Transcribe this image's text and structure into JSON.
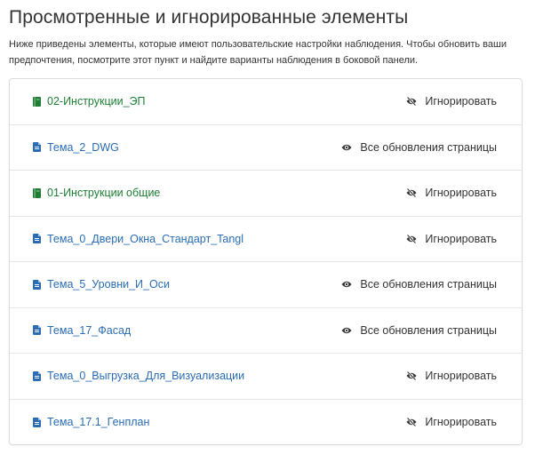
{
  "page": {
    "title": "Просмотренные и игнорированные элементы",
    "description": "Ниже приведены элементы, которые имеют пользовательские настройки наблюдения. Чтобы обновить ваши предпочтения, посмотрите этот пункт и найдите варианты наблюдения в боковой панели."
  },
  "colors": {
    "book_green": "#1e7e34",
    "page_blue": "#2a6db5",
    "text": "#333333"
  },
  "items": [
    {
      "name": "02-Инструкции_ЭП",
      "type": "book",
      "icon": "book-icon",
      "status": "Игнорировать",
      "status_icon": "eye-slash-icon"
    },
    {
      "name": "Тема_2_DWG",
      "type": "page",
      "icon": "page-icon",
      "status": "Все обновления страницы",
      "status_icon": "eye-icon"
    },
    {
      "name": "01-Инструкции общие",
      "type": "book",
      "icon": "book-icon",
      "status": "Игнорировать",
      "status_icon": "eye-slash-icon"
    },
    {
      "name": "Тема_0_Двери_Окна_Стандарт_Tangl",
      "type": "page",
      "icon": "page-icon",
      "status": "Игнорировать",
      "status_icon": "eye-slash-icon"
    },
    {
      "name": "Тема_5_Уровни_И_Оси",
      "type": "page",
      "icon": "page-icon",
      "status": "Все обновления страницы",
      "status_icon": "eye-icon"
    },
    {
      "name": "Тема_17_Фасад",
      "type": "page",
      "icon": "page-icon",
      "status": "Все обновления страницы",
      "status_icon": "eye-icon"
    },
    {
      "name": "Тема_0_Выгрузка_Для_Визуализации",
      "type": "page",
      "icon": "page-icon",
      "status": "Игнорировать",
      "status_icon": "eye-slash-icon"
    },
    {
      "name": "Тема_17.1_Генплан",
      "type": "page",
      "icon": "page-icon",
      "status": "Игнорировать",
      "status_icon": "eye-slash-icon"
    }
  ]
}
